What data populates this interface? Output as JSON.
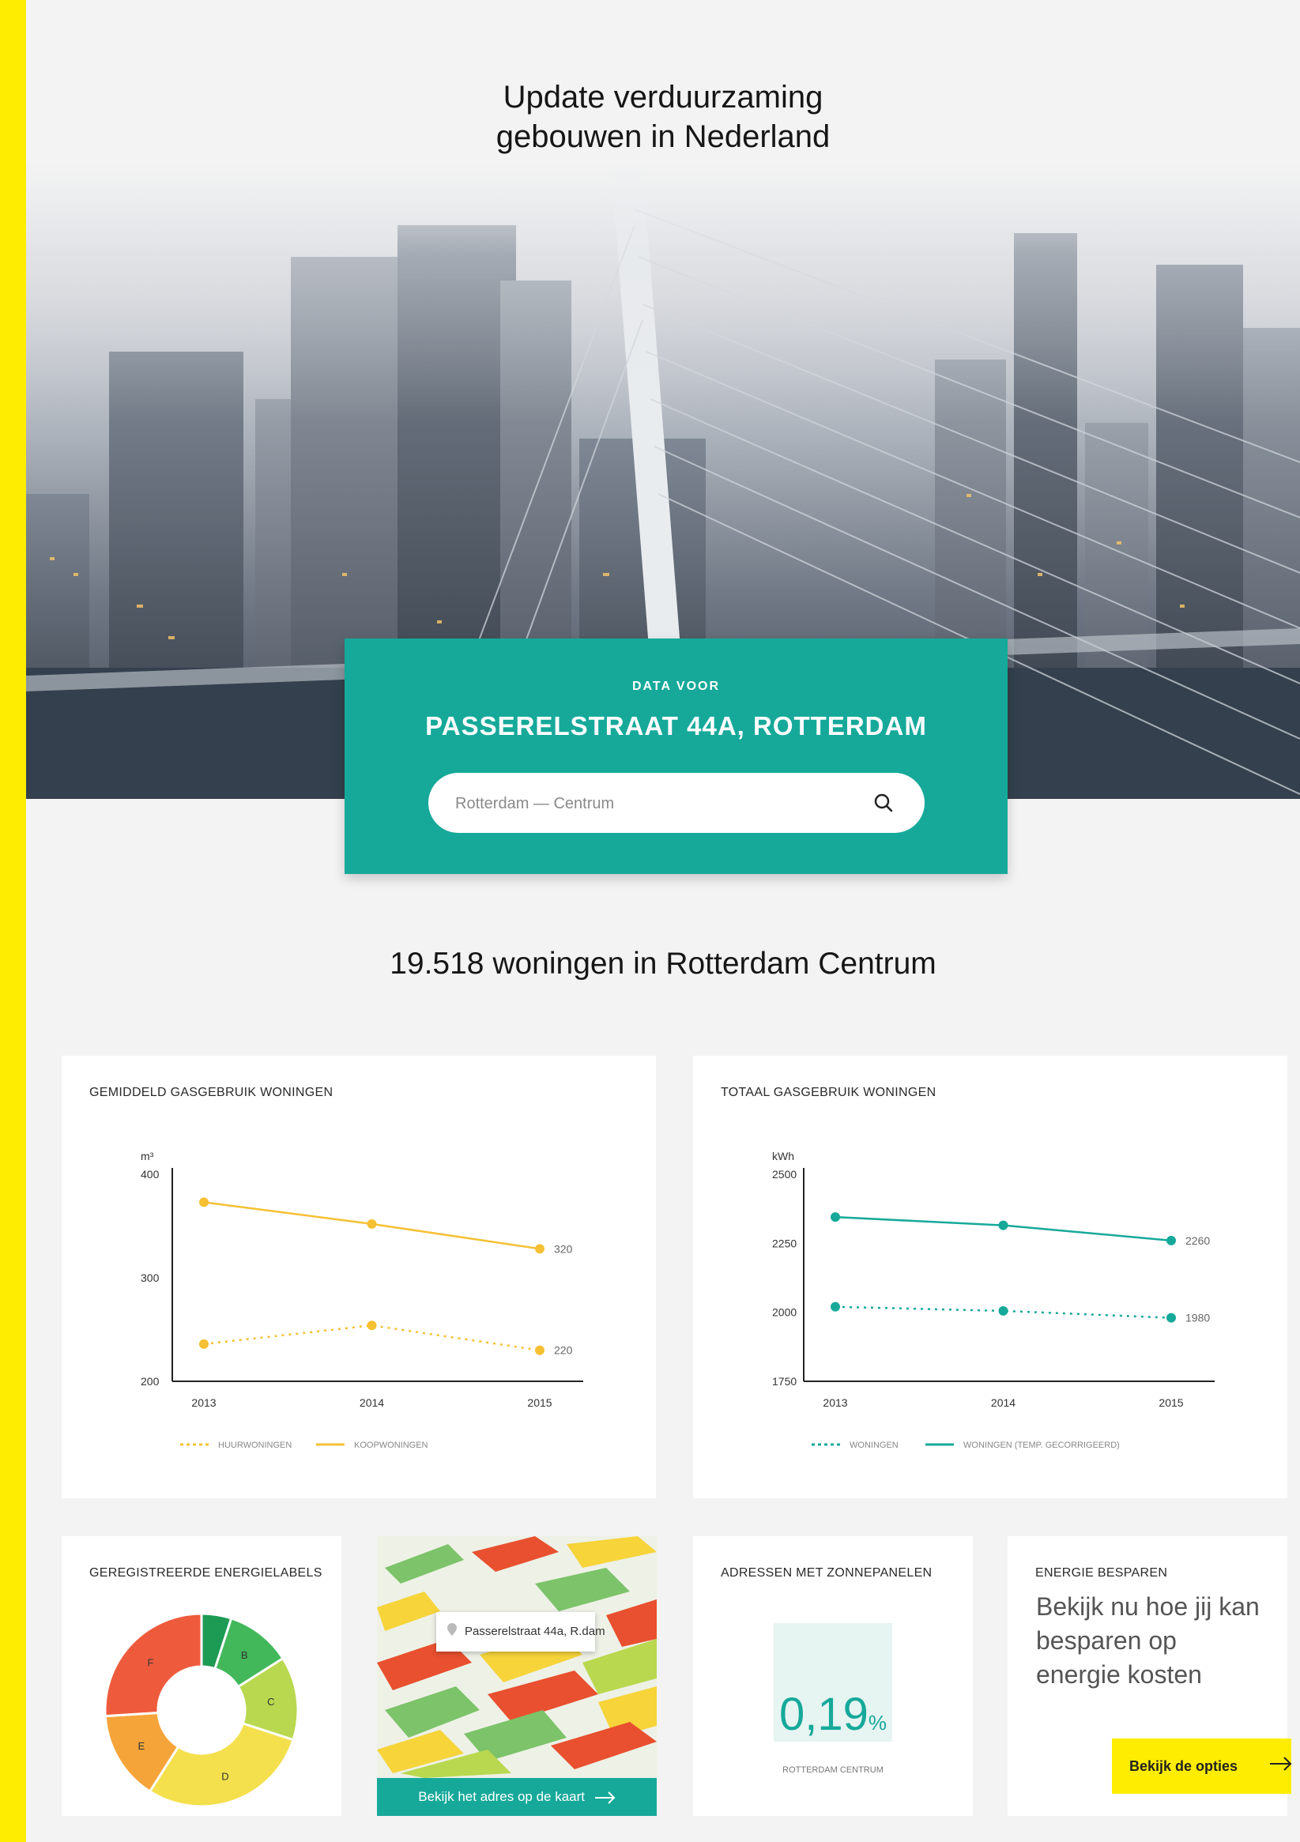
{
  "hero": {
    "title_line1": "Update verduurzaming",
    "title_line2": "gebouwen in Nederland"
  },
  "address_card": {
    "kicker": "DATA VOOR",
    "address": "PASSERELSTRAAT 44A, ROTTERDAM",
    "search_placeholder": "Rotterdam — Centrum",
    "search_icon": "search-icon"
  },
  "summary": {
    "heading": "19.518 woningen in Rotterdam Centrum"
  },
  "gas_avg": {
    "title": "GEMIDDELD GASGEBRUIK WONINGEN"
  },
  "gas_total": {
    "title": "TOTAAL GASGEBRUIK WONINGEN"
  },
  "chart_data": [
    {
      "type": "line",
      "title": "GEMIDDELD GASGEBRUIK WONINGEN",
      "ylabel": "m³",
      "x": [
        "2013",
        "2014",
        "2015"
      ],
      "ylim": [
        200,
        400
      ],
      "yticks": [
        "400",
        "300",
        "200"
      ],
      "series": [
        {
          "name": "HUURWONINGEN",
          "style": "dotted",
          "color": "#f5c033",
          "values": [
            236,
            254,
            230
          ],
          "end_label": "220"
        },
        {
          "name": "KOOPWONINGEN",
          "style": "solid",
          "color": "#f5c033",
          "values": [
            373,
            352,
            328
          ],
          "end_label": "320"
        }
      ]
    },
    {
      "type": "line",
      "title": "TOTAAL GASGEBRUIK WONINGEN",
      "ylabel": "kWh",
      "x": [
        "2013",
        "2014",
        "2015"
      ],
      "ylim": [
        1750,
        2500
      ],
      "yticks": [
        "2500",
        "2250",
        "2000",
        "1750"
      ],
      "series": [
        {
          "name": "WONINGEN",
          "style": "dotted",
          "color": "#16a99a",
          "values": [
            2020,
            2005,
            1980
          ],
          "end_label": "1980"
        },
        {
          "name": "WONINGEN (TEMP. GECORRIGEERD)",
          "style": "solid",
          "color": "#16a99a",
          "values": [
            2345,
            2315,
            2260
          ],
          "end_label": "2260"
        }
      ]
    },
    {
      "type": "pie",
      "title": "GEREGISTREERDE ENERGIELABELS",
      "categories": [
        "A",
        "B",
        "C",
        "D",
        "E",
        "F"
      ],
      "values": [
        5,
        11,
        14,
        29,
        15,
        26
      ],
      "labels": [
        "",
        "B",
        "C",
        "D",
        "E",
        "F"
      ],
      "colors": [
        "#1d9a53",
        "#42b85b",
        "#b9d84f",
        "#f4e04d",
        "#f5a43a",
        "#ee5b3c"
      ]
    }
  ],
  "labels": {
    "title": "GEREGISTREERDE ENERGIELABELS"
  },
  "map": {
    "tooltip": "Passerelstraat 44a, R.dam",
    "link_label": "Bekijk het adres op de kaart",
    "arrow_icon": "arrow-right-icon"
  },
  "solar": {
    "title": "ADRESSEN MET ZONNEPANELEN",
    "value": "0,19",
    "unit": "%",
    "percent": 0.19,
    "caption": "ROTTERDAM CENTRUM"
  },
  "save": {
    "title": "ENERGIE BESPAREN",
    "text": "Bekijk nu hoe jij kan besparen op energie kosten",
    "button_label": "Bekijk de opties"
  }
}
